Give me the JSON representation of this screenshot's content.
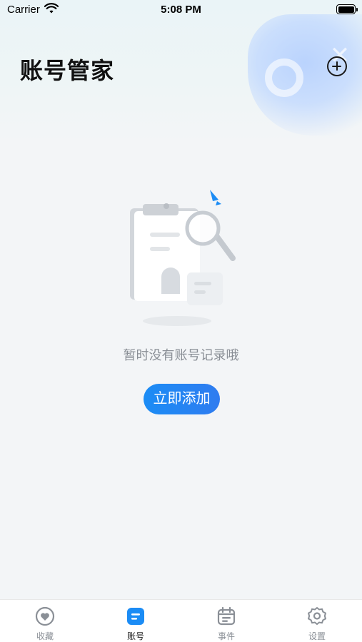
{
  "status_bar": {
    "carrier": "Carrier",
    "time": "5:08 PM"
  },
  "header": {
    "title": "账号管家",
    "add_icon": "plus-circle-icon"
  },
  "empty_state": {
    "illustration_icon": "clipboard-search-icon",
    "message": "暂时没有账号记录哦",
    "action_label": "立即添加"
  },
  "tab_bar": {
    "items": [
      {
        "label": "收藏",
        "icon": "heart-icon",
        "active": false
      },
      {
        "label": "账号",
        "icon": "account-list-icon",
        "active": true
      },
      {
        "label": "事件",
        "icon": "calendar-icon",
        "active": false
      },
      {
        "label": "设置",
        "icon": "gear-icon",
        "active": false
      }
    ]
  },
  "colors": {
    "accent": "#1b8cf5",
    "background": "#f3f5f7",
    "inactive_tab": "#8a8f96",
    "active_tab_label": "#1a1a1a"
  }
}
